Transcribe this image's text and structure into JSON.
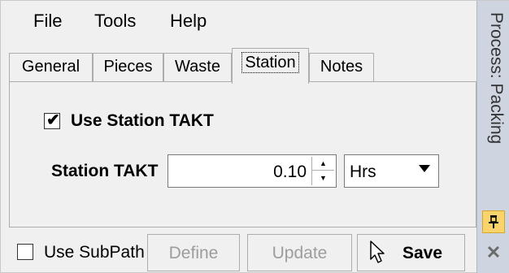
{
  "menu": {
    "file": "File",
    "tools": "Tools",
    "help": "Help"
  },
  "tabs": {
    "general": "General",
    "pieces": "Pieces",
    "waste": "Waste",
    "station": "Station",
    "notes": "Notes",
    "active": "Station"
  },
  "station": {
    "use_takt_label": "Use Station TAKT",
    "use_takt_checked": true,
    "takt_label": "Station TAKT",
    "takt_value": "0.10",
    "unit_selected": "Hrs"
  },
  "bottom": {
    "use_subpath_label": "Use SubPath",
    "use_subpath_checked": false,
    "define_label": "Define",
    "update_label": "Update",
    "save_label": "Save"
  },
  "side_panel": {
    "title": "Process: Packing",
    "pin_icon": "pin-icon",
    "close_icon": "close-icon"
  }
}
